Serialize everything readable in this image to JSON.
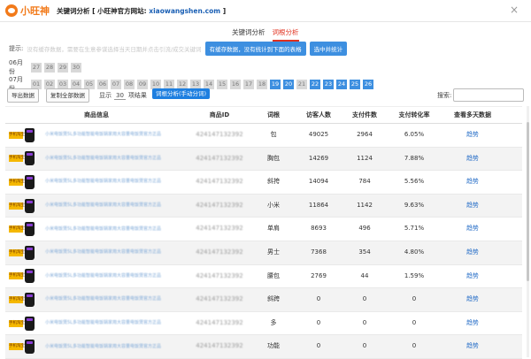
{
  "window": {
    "logo_text": "小旺神",
    "title": "关键词分析 [ 小旺神官方网站: ",
    "site": "xiaowangshen.com",
    "title_end": " ]",
    "close": "×"
  },
  "tabs": [
    {
      "label": "关键词分析",
      "active": false
    },
    {
      "label": "词根分析",
      "active": true
    }
  ],
  "tips": {
    "label": "提示:",
    "grey_text": "没有缓存数据，需要在生意参谋选择当天日期并点击引流/成交关键词",
    "btn_cache": "有缓存数据，没有统计到下面的表格",
    "btn_stats": "选中并统计"
  },
  "months": [
    {
      "label": "06月份",
      "days": [
        {
          "d": "27",
          "sel": false
        },
        {
          "d": "28",
          "sel": false
        },
        {
          "d": "29",
          "sel": false
        },
        {
          "d": "30",
          "sel": false
        }
      ]
    },
    {
      "label": "07月份",
      "days": [
        {
          "d": "01",
          "sel": false
        },
        {
          "d": "02",
          "sel": false
        },
        {
          "d": "03",
          "sel": false
        },
        {
          "d": "04",
          "sel": false
        },
        {
          "d": "05",
          "sel": false
        },
        {
          "d": "06",
          "sel": false
        },
        {
          "d": "07",
          "sel": false
        },
        {
          "d": "08",
          "sel": false
        },
        {
          "d": "09",
          "sel": false
        },
        {
          "d": "10",
          "sel": false
        },
        {
          "d": "11",
          "sel": false
        },
        {
          "d": "12",
          "sel": false
        },
        {
          "d": "13",
          "sel": false
        },
        {
          "d": "14",
          "sel": false
        },
        {
          "d": "15",
          "sel": false
        },
        {
          "d": "16",
          "sel": false
        },
        {
          "d": "17",
          "sel": false
        },
        {
          "d": "18",
          "sel": false
        },
        {
          "d": "19",
          "sel": true
        },
        {
          "d": "20",
          "sel": true
        },
        {
          "d": "21",
          "sel": false
        },
        {
          "d": "22",
          "sel": true
        },
        {
          "d": "23",
          "sel": true
        },
        {
          "d": "24",
          "sel": true
        },
        {
          "d": "25",
          "sel": true
        },
        {
          "d": "26",
          "sel": true
        }
      ]
    }
  ],
  "controls": {
    "export": "导出数据",
    "copy_all": "复制全部数据",
    "show_label": "显示",
    "show_value": "30",
    "show_suffix": "项结果",
    "split_btn": "词根分析(手动分词)",
    "search_label": "搜索:"
  },
  "table": {
    "headers": [
      "商品信息",
      "商品ID",
      "词根",
      "访客人数",
      "支付件数",
      "支付转化率",
      "查看多天数据"
    ],
    "promo_label": "手机淘宝",
    "product_title": "小米电饭煲5L多功能智能电饭锅家用大容量电饭煲官方正品",
    "product_id": "424147132392",
    "trend_label": "趋势",
    "rows": [
      {
        "word": "包",
        "visitors": "49025",
        "payments": "2964",
        "rate": "6.05%"
      },
      {
        "word": "胸包",
        "visitors": "14269",
        "payments": "1124",
        "rate": "7.88%"
      },
      {
        "word": "斜挎",
        "visitors": "14094",
        "payments": "784",
        "rate": "5.56%"
      },
      {
        "word": "小米",
        "visitors": "11864",
        "payments": "1142",
        "rate": "9.63%"
      },
      {
        "word": "单肩",
        "visitors": "8693",
        "payments": "496",
        "rate": "5.71%"
      },
      {
        "word": "男士",
        "visitors": "7368",
        "payments": "354",
        "rate": "4.80%"
      },
      {
        "word": "腰包",
        "visitors": "2769",
        "payments": "44",
        "rate": "1.59%"
      },
      {
        "word": "斜跨",
        "visitors": "0",
        "payments": "0",
        "rate": "0"
      },
      {
        "word": "多",
        "visitors": "0",
        "payments": "0",
        "rate": "0"
      },
      {
        "word": "功能",
        "visitors": "0",
        "payments": "0",
        "rate": "0"
      }
    ]
  }
}
